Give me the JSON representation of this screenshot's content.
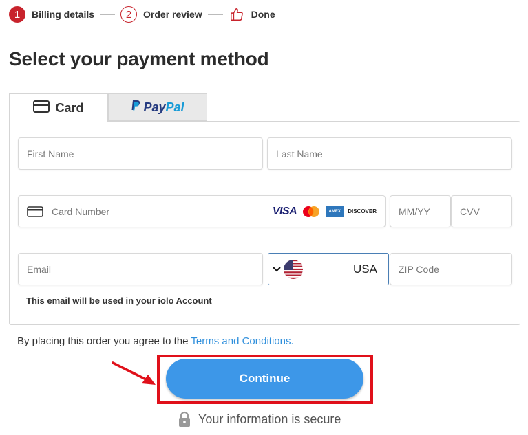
{
  "stepper": {
    "steps": [
      {
        "number": "1",
        "label": "Billing details"
      },
      {
        "number": "2",
        "label": "Order review"
      },
      {
        "label": "Done"
      }
    ]
  },
  "page_title": "Select your payment method",
  "tabs": {
    "card_label": "Card",
    "paypal_pay": "Pay",
    "paypal_pal": "Pal"
  },
  "form": {
    "first_name_placeholder": "First Name",
    "last_name_placeholder": "Last Name",
    "card_number_placeholder": "Card Number",
    "expiry_placeholder": "MM/YY",
    "cvv_placeholder": "CVV",
    "email_placeholder": "Email",
    "country_value": "USA",
    "zip_placeholder": "ZIP Code",
    "email_note": "This email will be used in your iolo Account"
  },
  "card_brands": {
    "visa": "VISA",
    "amex": "AMEX",
    "discover": "DISCOVER"
  },
  "agreement": {
    "text": "By placing this order you agree to the ",
    "link": "Terms and Conditions."
  },
  "continue_label": "Continue",
  "secure_text": "Your information is secure",
  "colors": {
    "accent_red": "#c8232c",
    "button_blue": "#3d97e8",
    "link_blue": "#2f8fdc",
    "highlight_red": "#e0101a"
  }
}
